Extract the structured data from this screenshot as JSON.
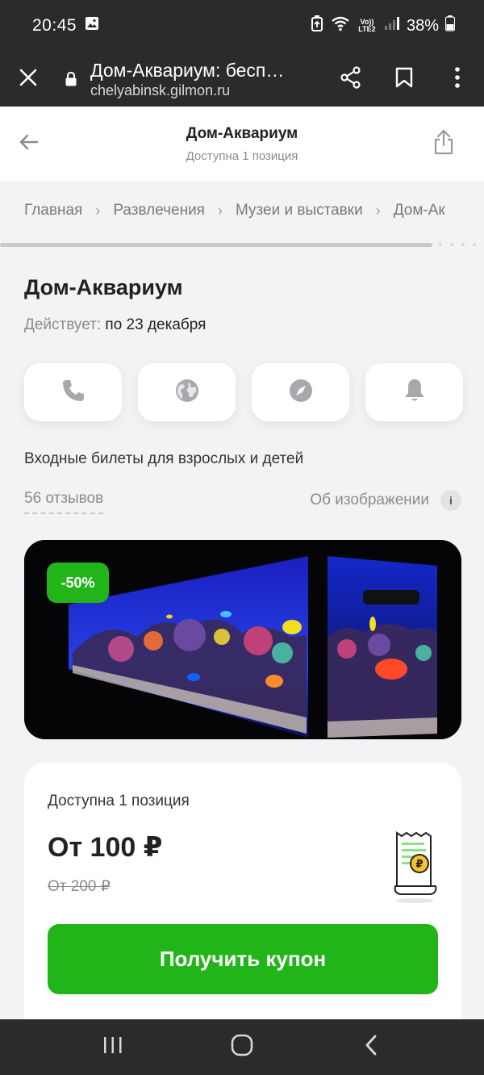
{
  "status": {
    "time": "20:45",
    "lte": "Vo)) LTE2",
    "battery": "38%"
  },
  "browser": {
    "title": "Дом-Аквариум: бесп…",
    "host": "chelyabinsk.gilmon.ru"
  },
  "header": {
    "title": "Дом-Аквариум",
    "subtitle": "Доступна 1 позиция"
  },
  "breadcrumbs": [
    "Главная",
    "Развлечения",
    "Музеи и выставки",
    "Дом-Ак"
  ],
  "main": {
    "title": "Дом-Аквариум",
    "valid_label": "Действует:",
    "valid_value": "по 23 декабря",
    "description": "Входные билеты для взрослых и детей",
    "reviews": "56 отзывов",
    "about_image": "Об изображении",
    "info": "i",
    "discount": "-50%",
    "actions": [
      "phone-icon",
      "globe-icon",
      "compass-icon",
      "bell-icon"
    ]
  },
  "offer": {
    "available": "Доступна 1 позиция",
    "price": "От 100 ₽",
    "old_price": "От 200 ₽",
    "button": "Получить купон"
  },
  "colors": {
    "green": "#21b51a",
    "dark_bar": "#2b2b2c",
    "background": "#f3f3f5"
  }
}
